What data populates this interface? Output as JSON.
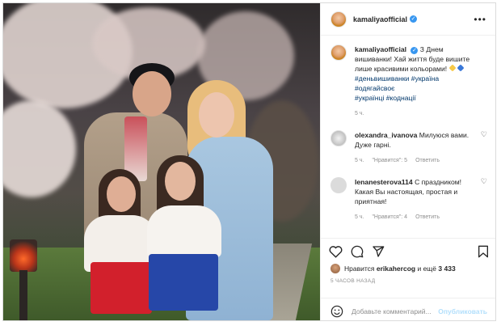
{
  "post": {
    "username": "kamaliyaofficial",
    "verified_mark": "✓",
    "more_icon": "•••",
    "caption_username": "kamaliyaofficial",
    "caption_text": "З Днем вишиванки! Хай життя буде вишите лише красивими кольорами!",
    "caption_tags_line1": "#деньвишиванки #україна",
    "caption_tags_line2": "#одягайсвоє",
    "caption_tags_line3": "#українці #коднації",
    "caption_time": "5 ч."
  },
  "comments": [
    {
      "username": "olexandra_ivanova",
      "text": "Милуюся вами. Дуже гарні.",
      "time": "5 ч.",
      "likes": "\"Нравится\": 5",
      "reply": "Ответить"
    },
    {
      "username": "lenanesterova114",
      "text": "С праздником! Какая Вы настоящая, простая и приятная!",
      "time": "5 ч.",
      "likes": "\"Нравится\": 4",
      "reply": "Ответить"
    }
  ],
  "likes": {
    "prefix": "Нравится",
    "user": "erikahercog",
    "and": "и ещё",
    "count": "3 433"
  },
  "date_text": "5 ЧАСОВ НАЗАД",
  "add_comment": {
    "placeholder": "Добавьте комментарий...",
    "post_label": "Опубликовать"
  },
  "icons": [
    "heart-icon",
    "comment-icon",
    "share-icon",
    "bookmark-icon",
    "emoji-icon",
    "more-icon"
  ],
  "colors": {
    "link": "#00376b",
    "verified": "#3897f0",
    "muted": "#8e8e8e",
    "post_button": "#b2dffc"
  }
}
